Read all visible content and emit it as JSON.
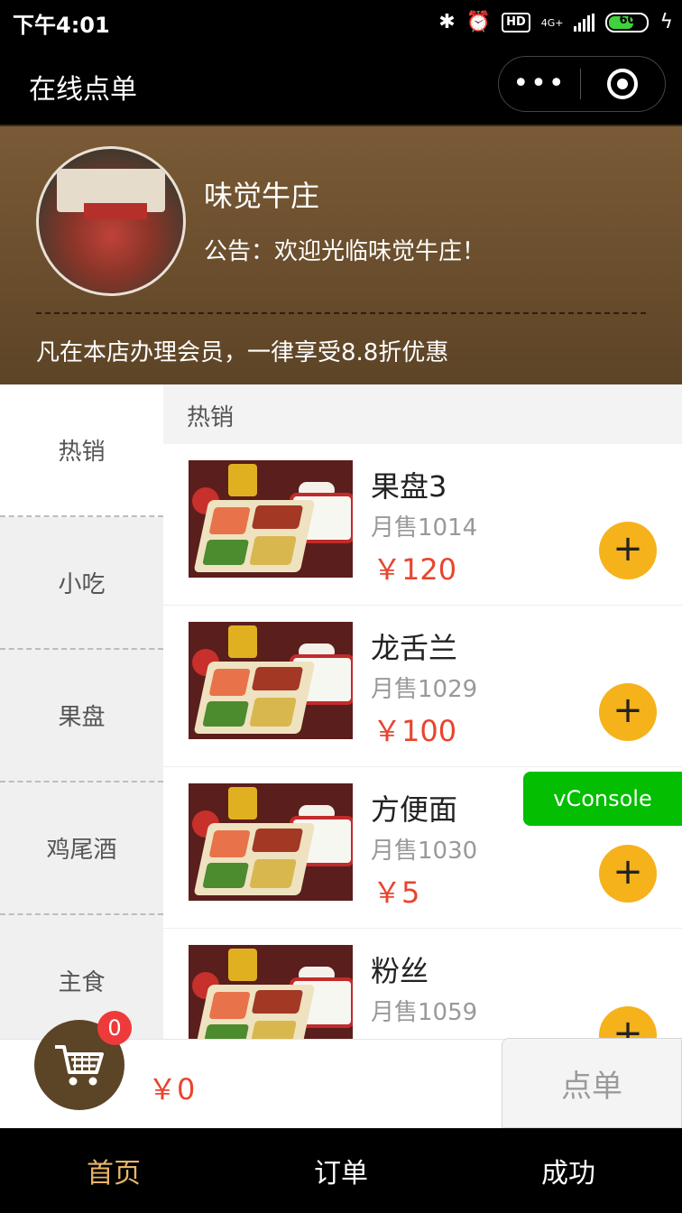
{
  "status": {
    "time": "下午4:01",
    "network": "4G+",
    "battery": "60",
    "hd": "HD"
  },
  "nav": {
    "title": "在线点单",
    "more_glyph": "•••"
  },
  "shop": {
    "name": "味觉牛庄",
    "notice": "公告：欢迎光临味觉牛庄！",
    "promo": "凡在本店办理会员，一律享受8.8折优惠"
  },
  "categories": [
    "热销",
    "小吃",
    "果盘",
    "鸡尾酒",
    "主食"
  ],
  "section_title": "热销",
  "products": [
    {
      "name": "果盘3",
      "sold": "月售1014",
      "price": "￥120"
    },
    {
      "name": "龙舌兰",
      "sold": "月售1029",
      "price": "￥100"
    },
    {
      "name": "方便面",
      "sold": "月售1030",
      "price": "￥5"
    },
    {
      "name": "粉丝",
      "sold": "月售1059",
      "price": ""
    }
  ],
  "add_glyph": "+",
  "vconsole": "vConsole",
  "cart": {
    "count": "0",
    "total": "￥0",
    "order_label": "点单"
  },
  "tabs": [
    {
      "label": "首页",
      "active": true
    },
    {
      "label": "订单",
      "active": false
    },
    {
      "label": "成功",
      "active": false
    }
  ],
  "colors": {
    "accent": "#f5b21b",
    "price": "#e8452e",
    "header_brown": "#6b4e2e",
    "tab_active": "#e8b568",
    "vconsole_green": "#04be02"
  },
  "icons": {
    "cart": "shopping-cart-icon",
    "add": "plus-icon",
    "close": "record-icon",
    "more": "more-dots-icon"
  }
}
